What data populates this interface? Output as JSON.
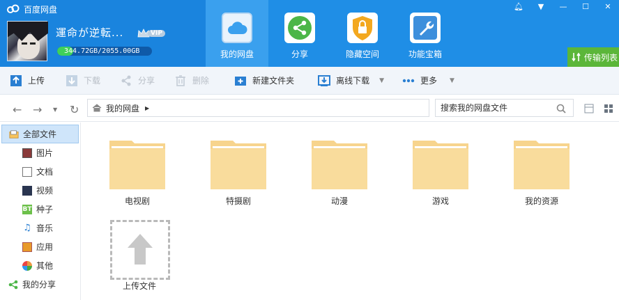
{
  "app": {
    "title": "百度网盘"
  },
  "user": {
    "name": "運命が逆転...",
    "vip_label": "VIP",
    "quota_text": "344.72GB/2055.00GB",
    "quota_used_fraction": 0.168
  },
  "nav": [
    {
      "label": "我的网盘",
      "icon": "cloud-icon",
      "active": true
    },
    {
      "label": "分享",
      "icon": "share-icon"
    },
    {
      "label": "隐藏空间",
      "icon": "lock-icon"
    },
    {
      "label": "功能宝箱",
      "icon": "wrench-icon"
    }
  ],
  "window_buttons": [
    "bell-icon",
    "menu-icon",
    "minimize-icon",
    "maximize-icon",
    "close-icon"
  ],
  "transfer_label": "传输列表",
  "toolbar": {
    "upload": "上传",
    "download": "下载",
    "share": "分享",
    "delete": "删除",
    "new_folder": "新建文件夹",
    "offline_download": "离线下载",
    "more": "更多"
  },
  "address": {
    "path": "我的网盘",
    "search_placeholder": "搜索我的网盘文件"
  },
  "sidebar": {
    "items": [
      {
        "label": "全部文件",
        "icon": "all-files-icon"
      },
      {
        "label": "图片",
        "icon": "picture-icon"
      },
      {
        "label": "文档",
        "icon": "document-icon"
      },
      {
        "label": "视频",
        "icon": "video-icon"
      },
      {
        "label": "种子",
        "icon": "torrent-icon",
        "badge": "BT"
      },
      {
        "label": "音乐",
        "icon": "music-icon"
      },
      {
        "label": "应用",
        "icon": "app-icon"
      },
      {
        "label": "其他",
        "icon": "other-icon"
      },
      {
        "label": "我的分享",
        "icon": "my-share-icon"
      }
    ]
  },
  "folders": [
    {
      "label": "电视剧"
    },
    {
      "label": "特摄剧"
    },
    {
      "label": "动漫"
    },
    {
      "label": "游戏"
    },
    {
      "label": "我的资源"
    }
  ],
  "upload_tile": {
    "label": "上传文件"
  },
  "colors": {
    "header": "#1f8ee6",
    "active_tab": "#3aa0ee",
    "transfer": "#5bb639",
    "folder": "#f7d48d",
    "selected": "#cfe5fa"
  }
}
